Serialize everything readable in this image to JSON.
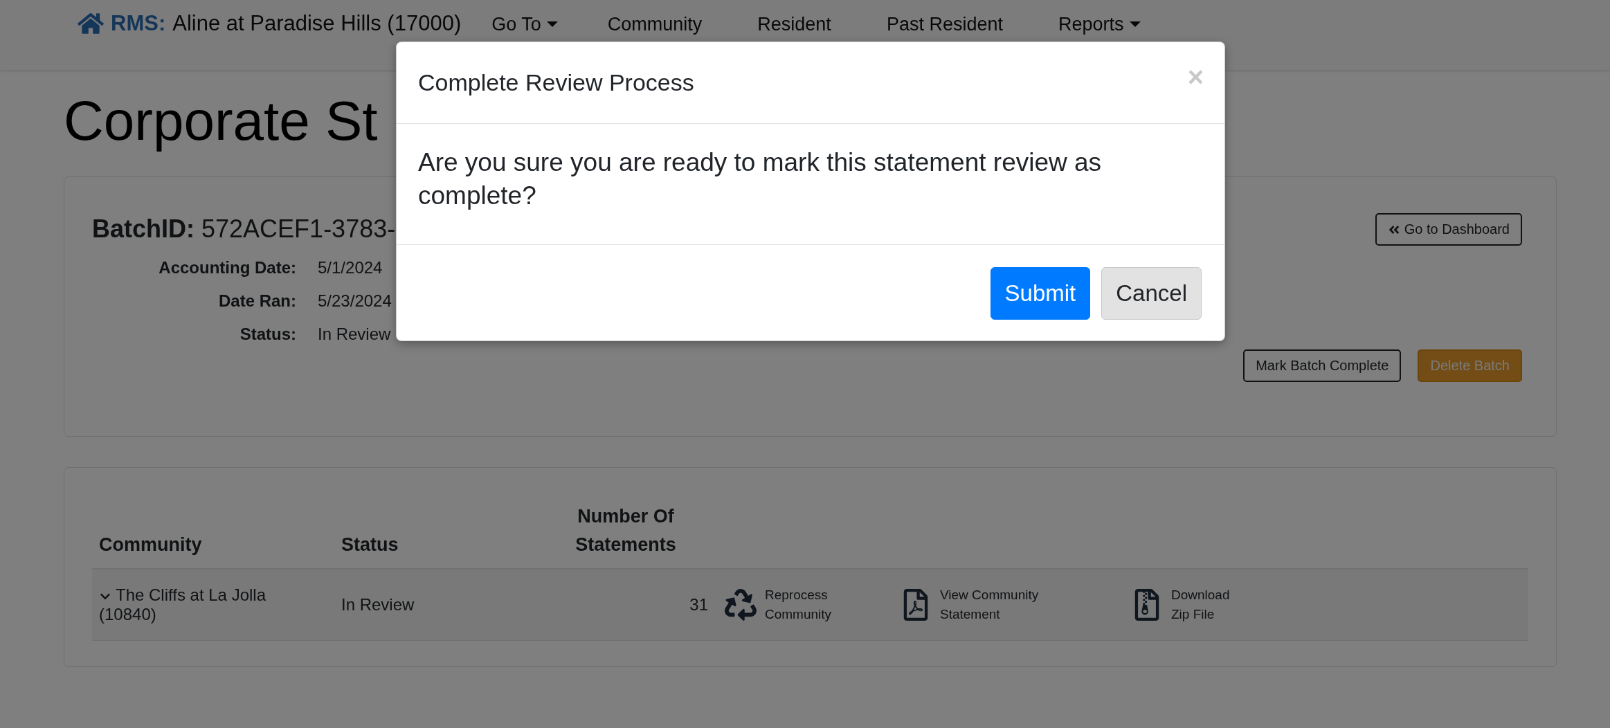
{
  "navbar": {
    "brand_prefix": "RMS:",
    "brand_name": "Aline at Paradise Hills (17000)",
    "items": [
      {
        "label": "Go To",
        "dropdown": true
      },
      {
        "label": "Community",
        "dropdown": false
      },
      {
        "label": "Resident",
        "dropdown": false
      },
      {
        "label": "Past Resident",
        "dropdown": false
      },
      {
        "label": "Reports",
        "dropdown": true
      }
    ]
  },
  "page_title": "Corporate St",
  "batch": {
    "label": "BatchID:",
    "id": "572ACEF1-3783-",
    "dashboard_button": "Go to Dashboard",
    "fields": [
      {
        "label": "Accounting Date:",
        "value": "5/1/2024"
      },
      {
        "label": "Date Ran:",
        "value": "5/23/2024"
      },
      {
        "label": "Status:",
        "value": "In Review"
      }
    ],
    "buttons": [
      {
        "label": "Mark Batch Complete",
        "kind": "outline"
      },
      {
        "label": "Delete Batch",
        "kind": "warning"
      }
    ]
  },
  "table": {
    "columns": [
      "Community",
      "Status",
      "Number Of Statements"
    ],
    "rows": [
      {
        "expanded": true,
        "community": "The Cliffs at La Jolla (10840)",
        "status": "In Review",
        "count": "31",
        "actions": [
          {
            "kind": "recycle",
            "lines": [
              "Reprocess",
              "Community"
            ]
          },
          {
            "kind": "pdf",
            "lines": [
              "View Community",
              "Statement"
            ]
          },
          {
            "kind": "zip",
            "lines": [
              "Download",
              "Zip File"
            ]
          }
        ]
      }
    ]
  },
  "modal": {
    "title": "Complete Review Process",
    "close": "×",
    "message": "Are you sure you are ready to mark this statement review as complete?",
    "buttons": [
      {
        "label": "Submit",
        "kind": "primary"
      },
      {
        "label": "Cancel",
        "kind": "secondary"
      }
    ]
  }
}
